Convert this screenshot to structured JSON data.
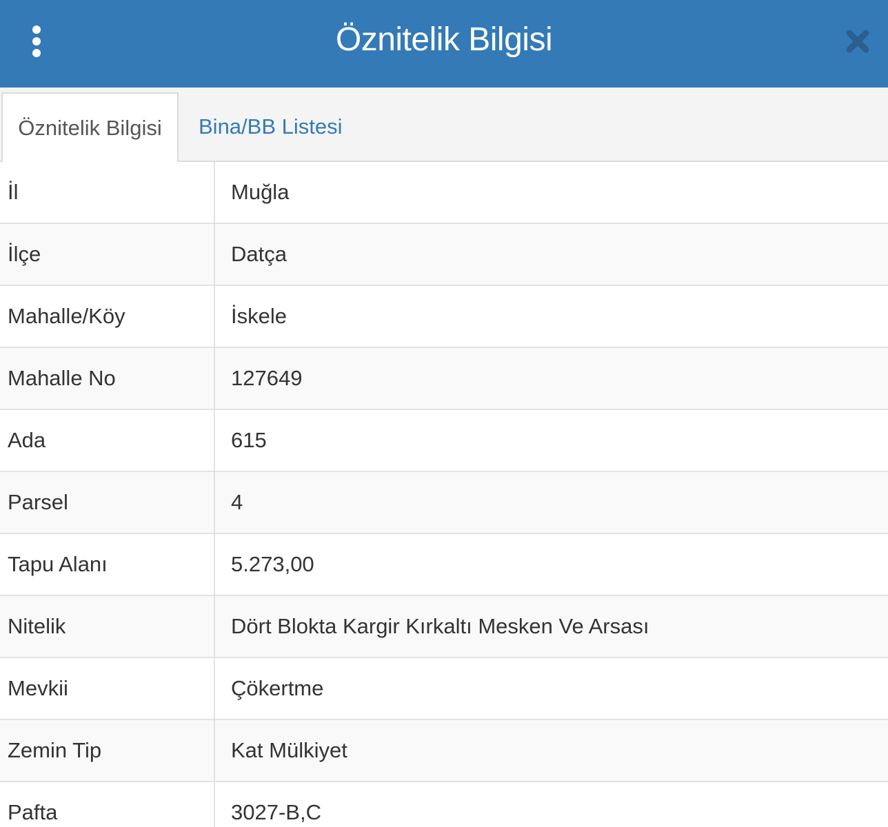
{
  "header": {
    "title": "Öznitelik Bilgisi",
    "menu_icon": "vertical-ellipsis-icon",
    "close_icon": "close-x-icon",
    "background_color": "#337ab7"
  },
  "tabs": [
    {
      "label": "Öznitelik Bilgisi",
      "active": true
    },
    {
      "label": "Bina/BB Listesi",
      "active": false
    }
  ],
  "attributes": [
    {
      "label": "İl",
      "value": "Muğla"
    },
    {
      "label": "İlçe",
      "value": "Datça"
    },
    {
      "label": "Mahalle/Köy",
      "value": "İskele"
    },
    {
      "label": "Mahalle No",
      "value": "127649"
    },
    {
      "label": "Ada",
      "value": "615"
    },
    {
      "label": "Parsel",
      "value": "4"
    },
    {
      "label": "Tapu Alanı",
      "value": "5.273,00"
    },
    {
      "label": "Nitelik",
      "value": "Dört Blokta Kargir Kırkaltı Mesken Ve Arsası"
    },
    {
      "label": "Mevkii",
      "value": "Çökertme"
    },
    {
      "label": "Zemin Tip",
      "value": "Kat Mülkiyet"
    },
    {
      "label": "Pafta",
      "value": "3027-B,C"
    }
  ]
}
